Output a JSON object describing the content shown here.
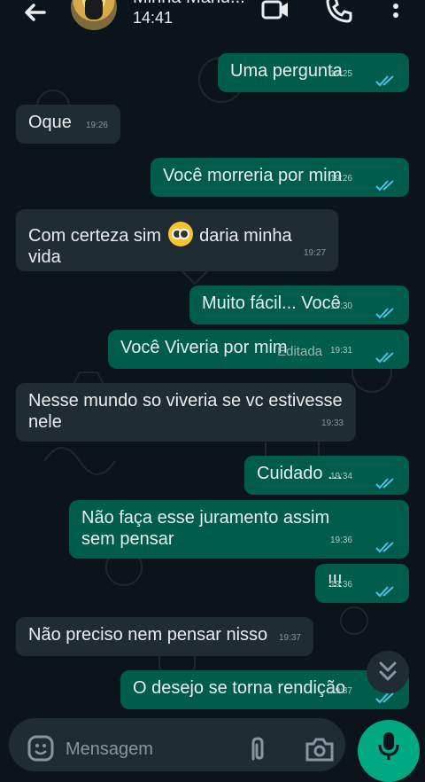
{
  "header": {
    "contact_name": "Minha Manu...",
    "status": "14:41"
  },
  "messages": [
    {
      "dir": "out",
      "text": "Uma pergunta",
      "time": "19:25"
    },
    {
      "dir": "in",
      "text": "Oque",
      "time": "19:26"
    },
    {
      "dir": "out",
      "text": "Você morreria por mim",
      "time": "19:26"
    },
    {
      "dir": "in",
      "text_before": "Com certeza sim",
      "text_after": "daria minha vida",
      "time": "19:27"
    },
    {
      "dir": "out",
      "text": "Muito fácil... Você",
      "time": "19:30"
    },
    {
      "dir": "out",
      "text": "Você Viveria por mim",
      "time": "19:31",
      "edited": "Editada"
    },
    {
      "dir": "in",
      "text": "Nesse mundo so viveria se vc estivesse nele",
      "time": "19:33"
    },
    {
      "dir": "out",
      "text": "Cuidado ...",
      "time": "19:34"
    },
    {
      "dir": "out",
      "text": "Não faça esse juramento assim sem pensar",
      "time": "19:36"
    },
    {
      "dir": "out",
      "text": "!!!",
      "time": "19:36"
    },
    {
      "dir": "in",
      "text": "Não preciso nem pensar nisso",
      "time": "19:37"
    },
    {
      "dir": "out",
      "text": "O desejo se torna rendição",
      "time": "19:37"
    }
  ],
  "composer": {
    "placeholder": "Mensagem"
  },
  "icons": {
    "back": "arrow-left-icon",
    "video": "video-call-icon",
    "call": "phone-icon",
    "menu": "more-vert-icon",
    "emoji": "emoji-icon",
    "attach": "paperclip-icon",
    "camera": "camera-icon",
    "mic": "microphone-icon",
    "scroll_down": "double-chevron-down-icon",
    "ticks": "double-check-icon"
  },
  "colors": {
    "background": "#0b141a",
    "outgoing_bubble": "#005c4b",
    "incoming_bubble": "#202c33",
    "read_ticks": "#53bdeb",
    "accent": "#00a884"
  }
}
